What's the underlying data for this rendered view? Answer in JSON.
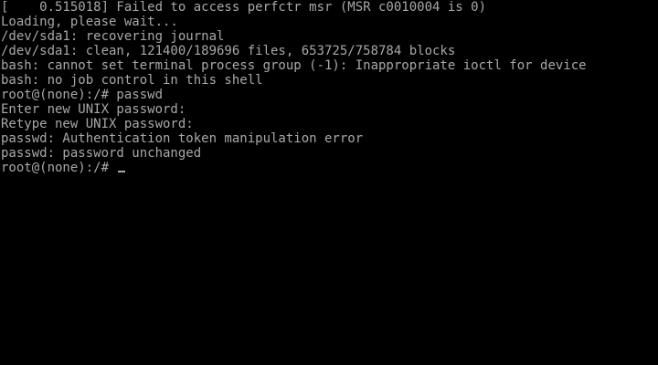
{
  "colors": {
    "background": "#000000",
    "text": "#a8a8a8"
  },
  "console": {
    "lines": [
      "[    0.515018] Failed to access perfctr msr (MSR c0010004 is 0)",
      "Loading, please wait...",
      "/dev/sda1: recovering journal",
      "/dev/sda1: clean, 121400/189696 files, 653725/758784 blocks",
      "bash: cannot set terminal process group (-1): Inappropriate ioctl for device",
      "bash: no job control in this shell",
      "root@(none):/# passwd",
      "Enter new UNIX password:",
      "Retype new UNIX password:",
      "passwd: Authentication token manipulation error",
      "passwd: password unchanged"
    ],
    "prompt": "root@(none):/# "
  }
}
